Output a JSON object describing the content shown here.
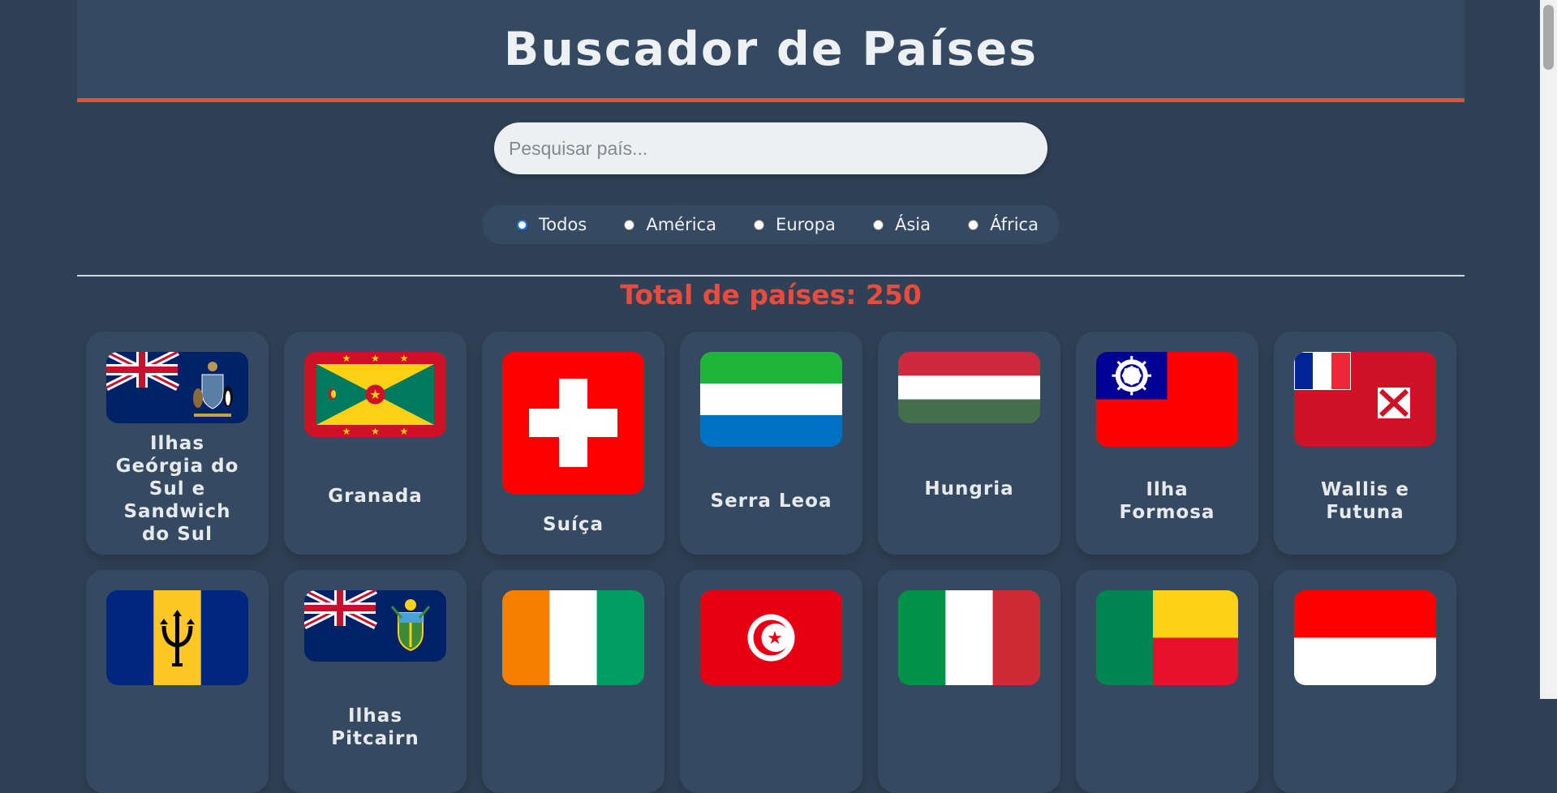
{
  "header": {
    "title": "Buscador de Países"
  },
  "search": {
    "placeholder": "Pesquisar país..."
  },
  "filters": [
    {
      "label": "Todos",
      "checked": true
    },
    {
      "label": "América",
      "checked": false
    },
    {
      "label": "Europa",
      "checked": false
    },
    {
      "label": "Ásia",
      "checked": false
    },
    {
      "label": "África",
      "checked": false
    }
  ],
  "total_text": "Total de países: 250",
  "countries": [
    {
      "name": "Ilhas Geórgia do Sul e Sandwich do Sul",
      "flag": "south-georgia-flag"
    },
    {
      "name": "Granada",
      "flag": "grenada-flag"
    },
    {
      "name": "Suíça",
      "flag": "switzerland-flag"
    },
    {
      "name": "Serra Leoa",
      "flag": "sierra-leone-flag"
    },
    {
      "name": "Hungria",
      "flag": "hungary-flag"
    },
    {
      "name": "Ilha Formosa",
      "flag": "taiwan-flag"
    },
    {
      "name": "Wallis e Futuna",
      "flag": "wallis-futuna-flag"
    },
    {
      "name": "",
      "flag": "barbados-flag"
    },
    {
      "name": "Ilhas Pitcairn",
      "flag": "pitcairn-flag"
    },
    {
      "name": "",
      "flag": "ivory-coast-flag"
    },
    {
      "name": "",
      "flag": "tunisia-flag"
    },
    {
      "name": "",
      "flag": "italy-flag"
    },
    {
      "name": "",
      "flag": "benin-flag"
    },
    {
      "name": "",
      "flag": "indonesia-flag"
    }
  ]
}
